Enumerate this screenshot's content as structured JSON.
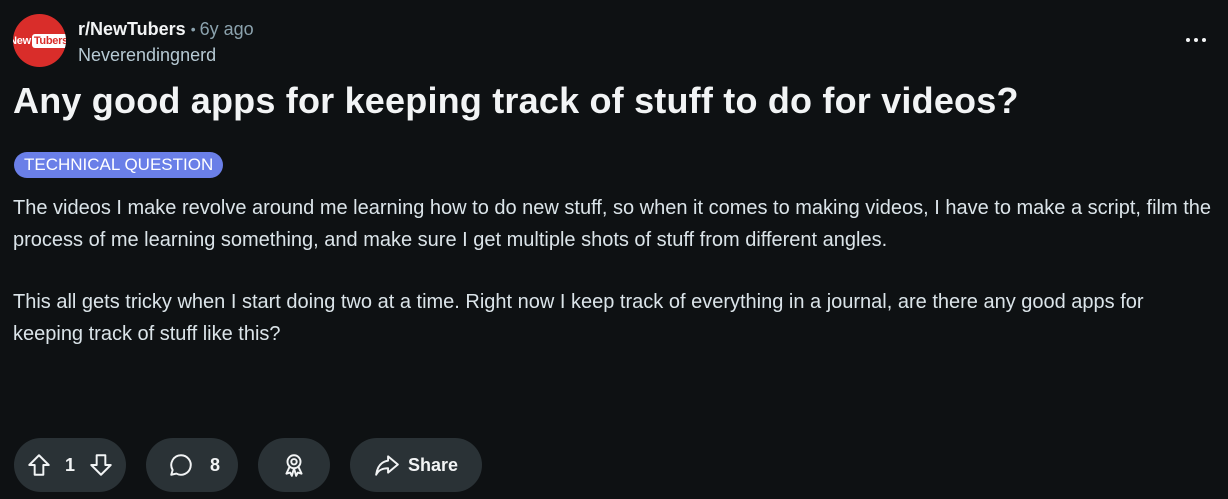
{
  "post": {
    "subreddit": "r/NewTubers",
    "time_ago": "6y ago",
    "separator": "•",
    "author": "Neverendingnerd",
    "avatar_logo": {
      "new": "New",
      "tubers": "Tubers"
    },
    "title": "Any good apps for keeping track of stuff to do for videos?",
    "flair": "TECHNICAL QUESTION",
    "flair_color": "#6a7fe8",
    "body": [
      "The videos I make revolve around me learning how to do new stuff, so when it comes to making videos, I have to make a script, film the process of me learning something, and make sure I get multiple shots of stuff from different angles.",
      "This all gets tricky when I start doing two at a time. Right now I keep track of everything in a journal, are there any good apps for keeping track of stuff like this?"
    ]
  },
  "actions": {
    "vote_count": "1",
    "comment_count": "8",
    "share_label": "Share"
  },
  "icons": {
    "more": "more-options-icon",
    "upvote": "upvote-arrow-icon",
    "downvote": "downvote-arrow-icon",
    "comment": "comment-bubble-icon",
    "award": "award-ribbon-icon",
    "share": "share-arrow-icon"
  },
  "colors": {
    "background": "#0e1113",
    "pill": "#2a3236",
    "avatar": "#d92d2a",
    "muted_text": "#8ba2ad"
  }
}
